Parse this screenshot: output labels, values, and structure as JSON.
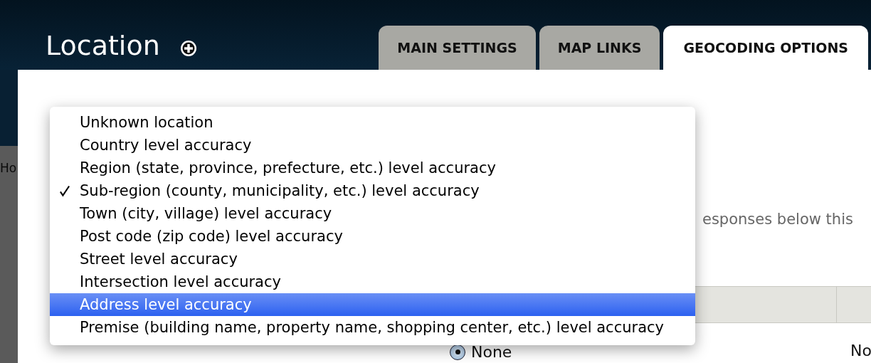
{
  "header": {
    "title": "Location"
  },
  "tabs": [
    {
      "label": "MAIN SETTINGS",
      "selected": false
    },
    {
      "label": "MAP LINKS",
      "selected": false
    },
    {
      "label": "GEOCODING OPTIONS",
      "selected": true
    }
  ],
  "sidebar": {
    "text": "Ho"
  },
  "content": {
    "description_fragment": "esponses below this",
    "table": {
      "row": {
        "option": {
          "label": "None",
          "selected": true
        },
        "column_3": "No"
      }
    }
  },
  "dropdown": {
    "items": [
      {
        "label": "Unknown location",
        "checked": false,
        "selected": false
      },
      {
        "label": "Country level accuracy",
        "checked": false,
        "selected": false
      },
      {
        "label": "Region (state, province, prefecture, etc.) level accuracy",
        "checked": false,
        "selected": false
      },
      {
        "label": "Sub-region (county, municipality, etc.) level accuracy",
        "checked": true,
        "selected": false
      },
      {
        "label": "Town (city, village) level accuracy",
        "checked": false,
        "selected": false
      },
      {
        "label": "Post code (zip code) level accuracy",
        "checked": false,
        "selected": false
      },
      {
        "label": "Street level accuracy",
        "checked": false,
        "selected": false
      },
      {
        "label": "Intersection level accuracy",
        "checked": false,
        "selected": false
      },
      {
        "label": "Address level accuracy",
        "checked": false,
        "selected": true
      },
      {
        "label": "Premise (building name, property name, shopping center, etc.) level accuracy",
        "checked": false,
        "selected": false
      }
    ]
  }
}
